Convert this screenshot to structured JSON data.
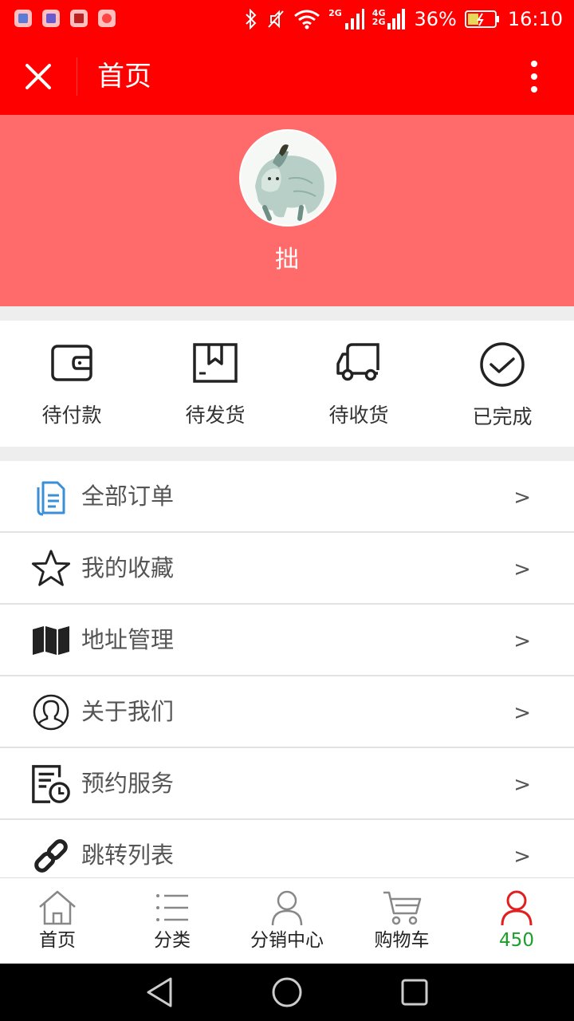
{
  "status_bar": {
    "network_1": "2G",
    "network_2_top": "4G",
    "network_2_bottom": "2G",
    "battery": "36%",
    "time": "16:10"
  },
  "app_bar": {
    "title": "首页",
    "close_icon": "close-icon",
    "more_icon": "more-vertical-icon"
  },
  "profile": {
    "username": "拙",
    "avatar": "bear-illustration-avatar"
  },
  "orders": [
    {
      "label": "待付款",
      "icon": "wallet-icon"
    },
    {
      "label": "待发货",
      "icon": "package-box-icon"
    },
    {
      "label": "待收货",
      "icon": "delivery-truck-icon"
    },
    {
      "label": "已完成",
      "icon": "check-circle-icon"
    }
  ],
  "menu": [
    {
      "label": "全部订单",
      "arrow": ">",
      "icon": "documents-icon"
    },
    {
      "label": "我的收藏",
      "arrow": ">",
      "icon": "star-icon"
    },
    {
      "label": "地址管理",
      "arrow": ">",
      "icon": "map-icon"
    },
    {
      "label": "关于我们",
      "arrow": ">",
      "icon": "user-circle-icon"
    },
    {
      "label": "预约服务",
      "arrow": ">",
      "icon": "schedule-clock-icon"
    },
    {
      "label": "跳转列表",
      "arrow": ">",
      "icon": "link-icon"
    }
  ],
  "tabs": [
    {
      "label": "首页",
      "icon": "home-icon"
    },
    {
      "label": "分类",
      "icon": "list-icon"
    },
    {
      "label": "分销中心",
      "icon": "person-icon"
    },
    {
      "label": "购物车",
      "icon": "cart-icon"
    },
    {
      "label": "450",
      "icon": "person-active-icon",
      "active": true
    }
  ],
  "colors": {
    "header_red": "#ff0000",
    "profile_bg": "#ff6a6a",
    "active_tab_icon": "#e02020",
    "active_tab_text": "#1a9f2a"
  }
}
